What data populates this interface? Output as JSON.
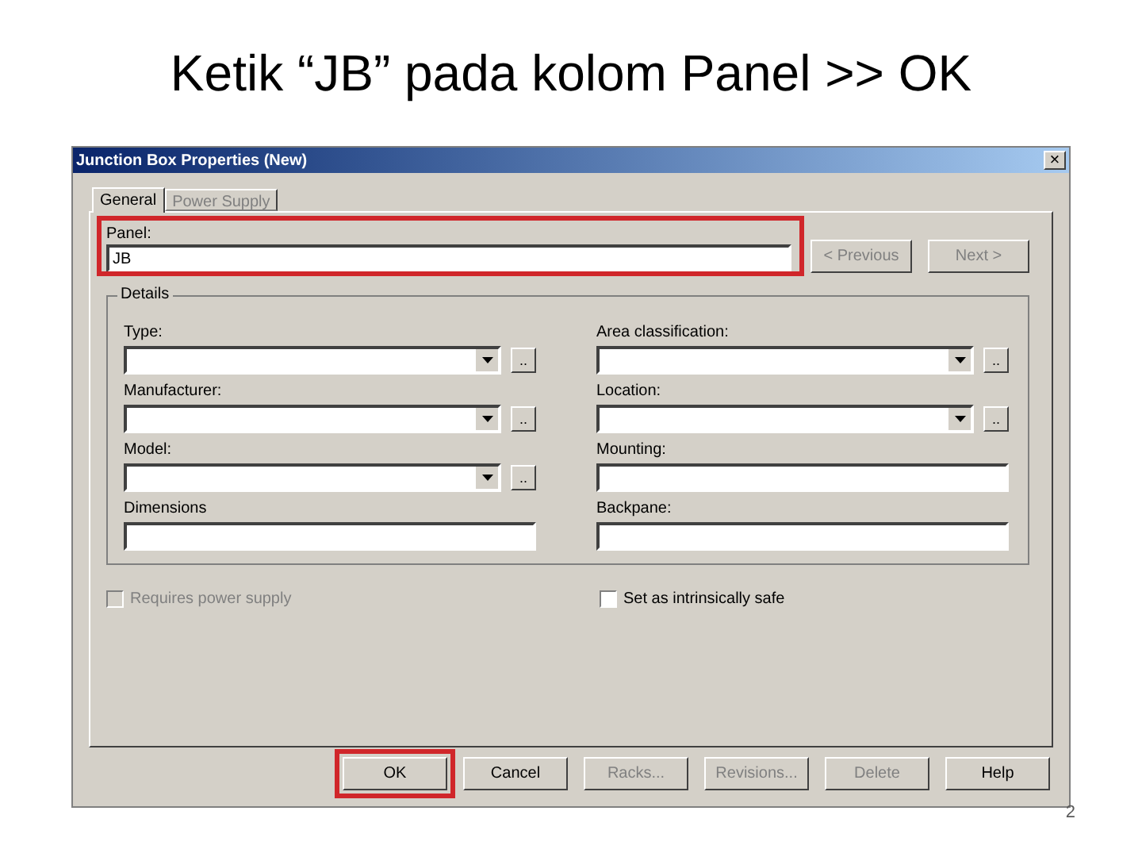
{
  "slide": {
    "title": "Ketik “JB” pada kolom Panel >> OK",
    "page_number": "2"
  },
  "window": {
    "title": "Junction Box Properties (New)",
    "close": "×"
  },
  "tabs": [
    {
      "label": "General",
      "selected": true
    },
    {
      "label": "Power Supply",
      "selected": false
    }
  ],
  "panel": {
    "label": "Panel:",
    "value": "JB",
    "highlighted": true
  },
  "nav_buttons": [
    {
      "label": "< Previous",
      "disabled": true
    },
    {
      "label": "Next >",
      "disabled": true
    }
  ],
  "details": {
    "title": "Details",
    "fields": [
      {
        "label": "Type:",
        "kind": "combo",
        "browse": ".."
      },
      {
        "label": "Area classification:",
        "kind": "combo",
        "browse": ".."
      },
      {
        "label": "Manufacturer:",
        "kind": "combo",
        "browse": ".."
      },
      {
        "label": "Location:",
        "kind": "combo",
        "browse": ".."
      },
      {
        "label": "Model:",
        "kind": "combo",
        "browse": ".."
      },
      {
        "label": "Mounting:",
        "kind": "text"
      },
      {
        "label": "Dimensions",
        "kind": "text"
      },
      {
        "label": "Backpane:",
        "kind": "text"
      }
    ]
  },
  "checkboxes": [
    {
      "label": "Requires power supply",
      "checked": false,
      "disabled": true
    },
    {
      "label": "Set as intrinsically safe",
      "checked": false,
      "disabled": false
    }
  ],
  "buttons": [
    {
      "label": "OK",
      "disabled": false,
      "highlighted": true
    },
    {
      "label": "Cancel",
      "disabled": false,
      "highlighted": false
    },
    {
      "label": "Racks...",
      "disabled": true,
      "highlighted": false
    },
    {
      "label": "Revisions...",
      "disabled": true,
      "highlighted": false
    },
    {
      "label": "Delete",
      "disabled": true,
      "highlighted": false
    },
    {
      "label": "Help",
      "disabled": false,
      "highlighted": false
    }
  ]
}
